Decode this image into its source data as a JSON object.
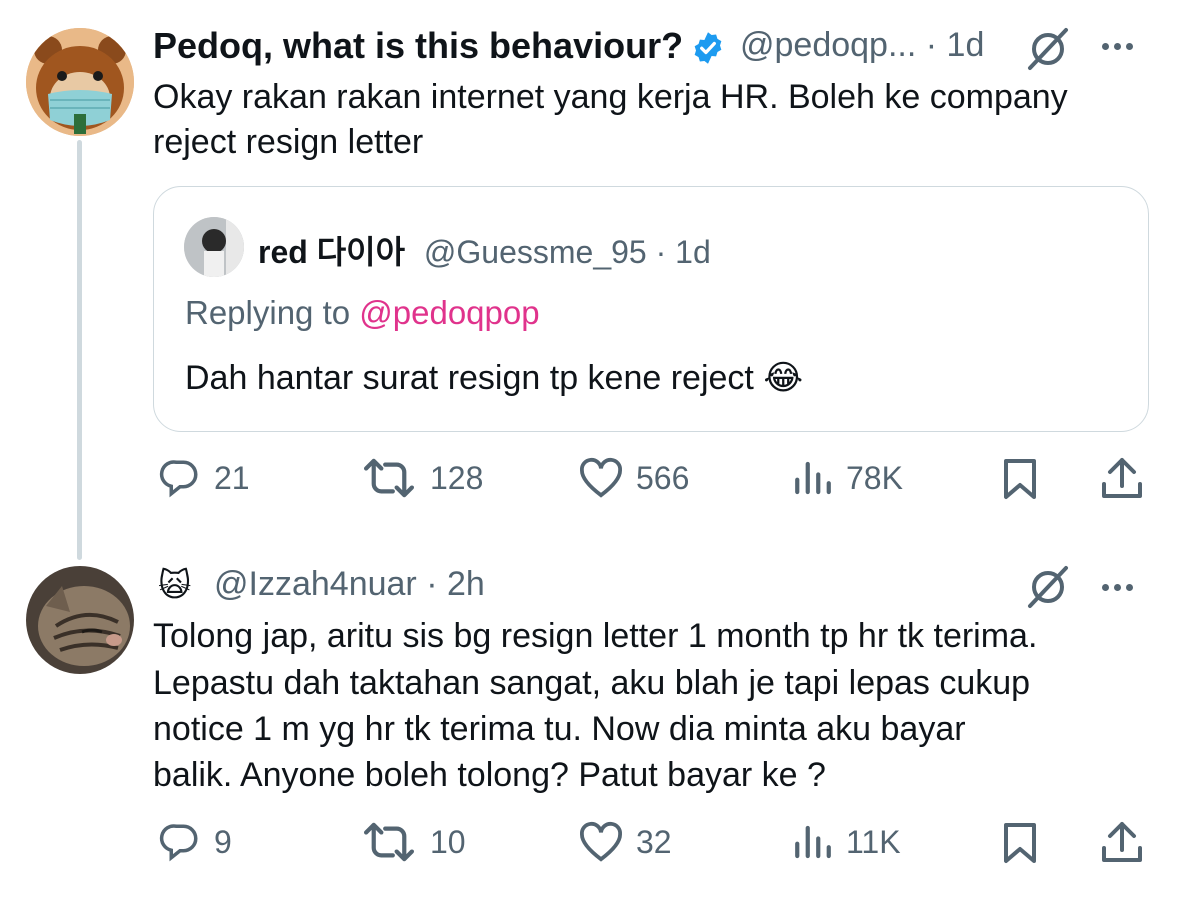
{
  "tweet1": {
    "display_name": "Pedoq, what is this behaviour?",
    "handle": "@pedoqp...",
    "sep": "·",
    "time": "1d",
    "text_line1": "Okay rakan rakan internet yang kerja HR. Boleh ke company",
    "text_line2": "reject resign letter",
    "verified_color": "#1d9bf0",
    "quote": {
      "display_name": "red 다이아",
      "handle": "@Guessme_95",
      "sep": "·",
      "time": "1d",
      "replying_prefix": "Replying to ",
      "replying_to": "@pedoqpop",
      "text": "Dah hantar surat resign tp kene reject",
      "emoji": "😂"
    },
    "actions": {
      "replies": "21",
      "reposts": "128",
      "likes": "566",
      "views": "78K"
    }
  },
  "tweet2": {
    "emoji_name": "🙀",
    "handle": "@Izzah4nuar",
    "sep": "·",
    "time": "2h",
    "text_line1": "Tolong jap, aritu sis bg resign letter 1 month tp hr tk terima.",
    "text_line2": "Lepastu dah taktahan sangat, aku blah je tapi lepas cukup",
    "text_line3": "notice 1 m yg hr tk terima tu. Now dia minta aku bayar",
    "text_line4": "balik. Anyone boleh tolong? Patut bayar ke ?",
    "actions": {
      "replies": "9",
      "reposts": "10",
      "likes": "32",
      "views": "11K"
    }
  },
  "colors": {
    "text": "#0f1419",
    "muted": "#536471",
    "border": "#cfd9de",
    "mention": "#e0338c",
    "verified": "#1d9bf0"
  },
  "icons": [
    "grok-icon",
    "more-icon",
    "reply-icon",
    "repost-icon",
    "like-icon",
    "views-icon",
    "bookmark-icon",
    "share-icon",
    "verified-badge-icon"
  ]
}
